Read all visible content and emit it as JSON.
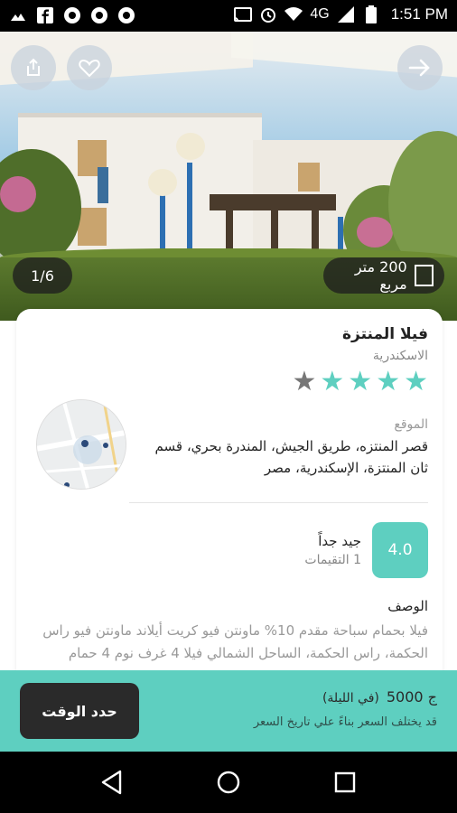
{
  "status_bar": {
    "network": "4G",
    "time": "1:51 PM"
  },
  "hero": {
    "photo_counter": "1/6",
    "area_text": "200 متر مربع"
  },
  "property": {
    "title": "فيلا المنتزة",
    "city": "الاسكندرية",
    "rating_stars": 4,
    "rating_stars_max": 5,
    "location_label": "الموقع",
    "address": "قصر المنتزه، طريق الجيش، المندرة بحري، قسم ثان المنتزة، الإسكندرية، مصر",
    "review_score": "4.0",
    "review_label": "جيد جداً",
    "review_count": "1 التقيمات",
    "description_label": "الوصف",
    "description": "فيلا بحمام سباحة مقدم 10% ماونتن فيو كريت أيلاند ماونتن فيو راس الحكمة، راس الحكمة، الساحل الشمالي فيلا 4 غرف نوم 4 حمام"
  },
  "booking": {
    "price": "5000 ج",
    "price_unit": "(في الليلة)",
    "price_note": "قد يختلف السعر بناءً علي تاريخ السعر",
    "button_label": "حدد الوقت"
  },
  "colors": {
    "accent": "#5ecfc0",
    "dark": "#2a2a2a"
  }
}
